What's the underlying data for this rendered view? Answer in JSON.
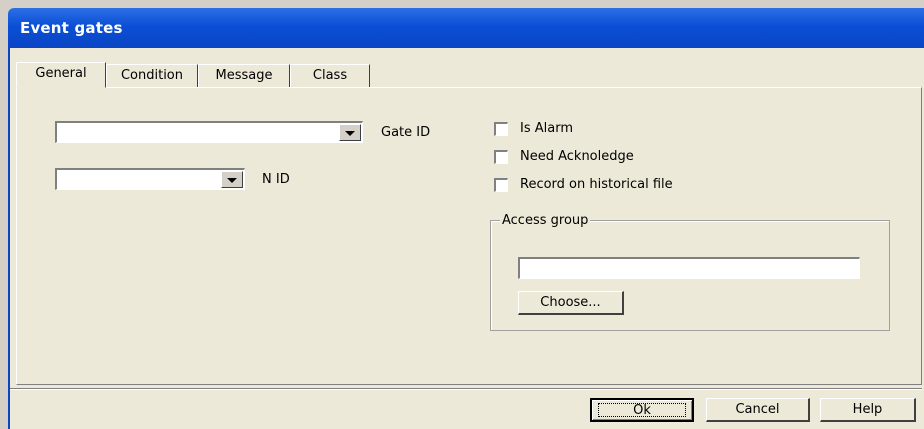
{
  "window": {
    "title": "Event gates"
  },
  "tabs": [
    {
      "label": "General",
      "active": true
    },
    {
      "label": "Condition",
      "active": false
    },
    {
      "label": "Message",
      "active": false
    },
    {
      "label": "Class",
      "active": false
    }
  ],
  "general": {
    "gate_id": {
      "label": "Gate ID",
      "value": ""
    },
    "n_id": {
      "label": "N ID",
      "value": ""
    },
    "checkboxes": [
      {
        "label": "Is Alarm",
        "checked": false
      },
      {
        "label": "Need Acknoledge",
        "checked": false
      },
      {
        "label": "Record on historical file",
        "checked": false
      }
    ],
    "access_group": {
      "legend": "Access group",
      "value": "",
      "choose_label": "Choose..."
    }
  },
  "footer": {
    "ok_label": "Ok",
    "cancel_label": "Cancel",
    "help_label": "Help"
  }
}
